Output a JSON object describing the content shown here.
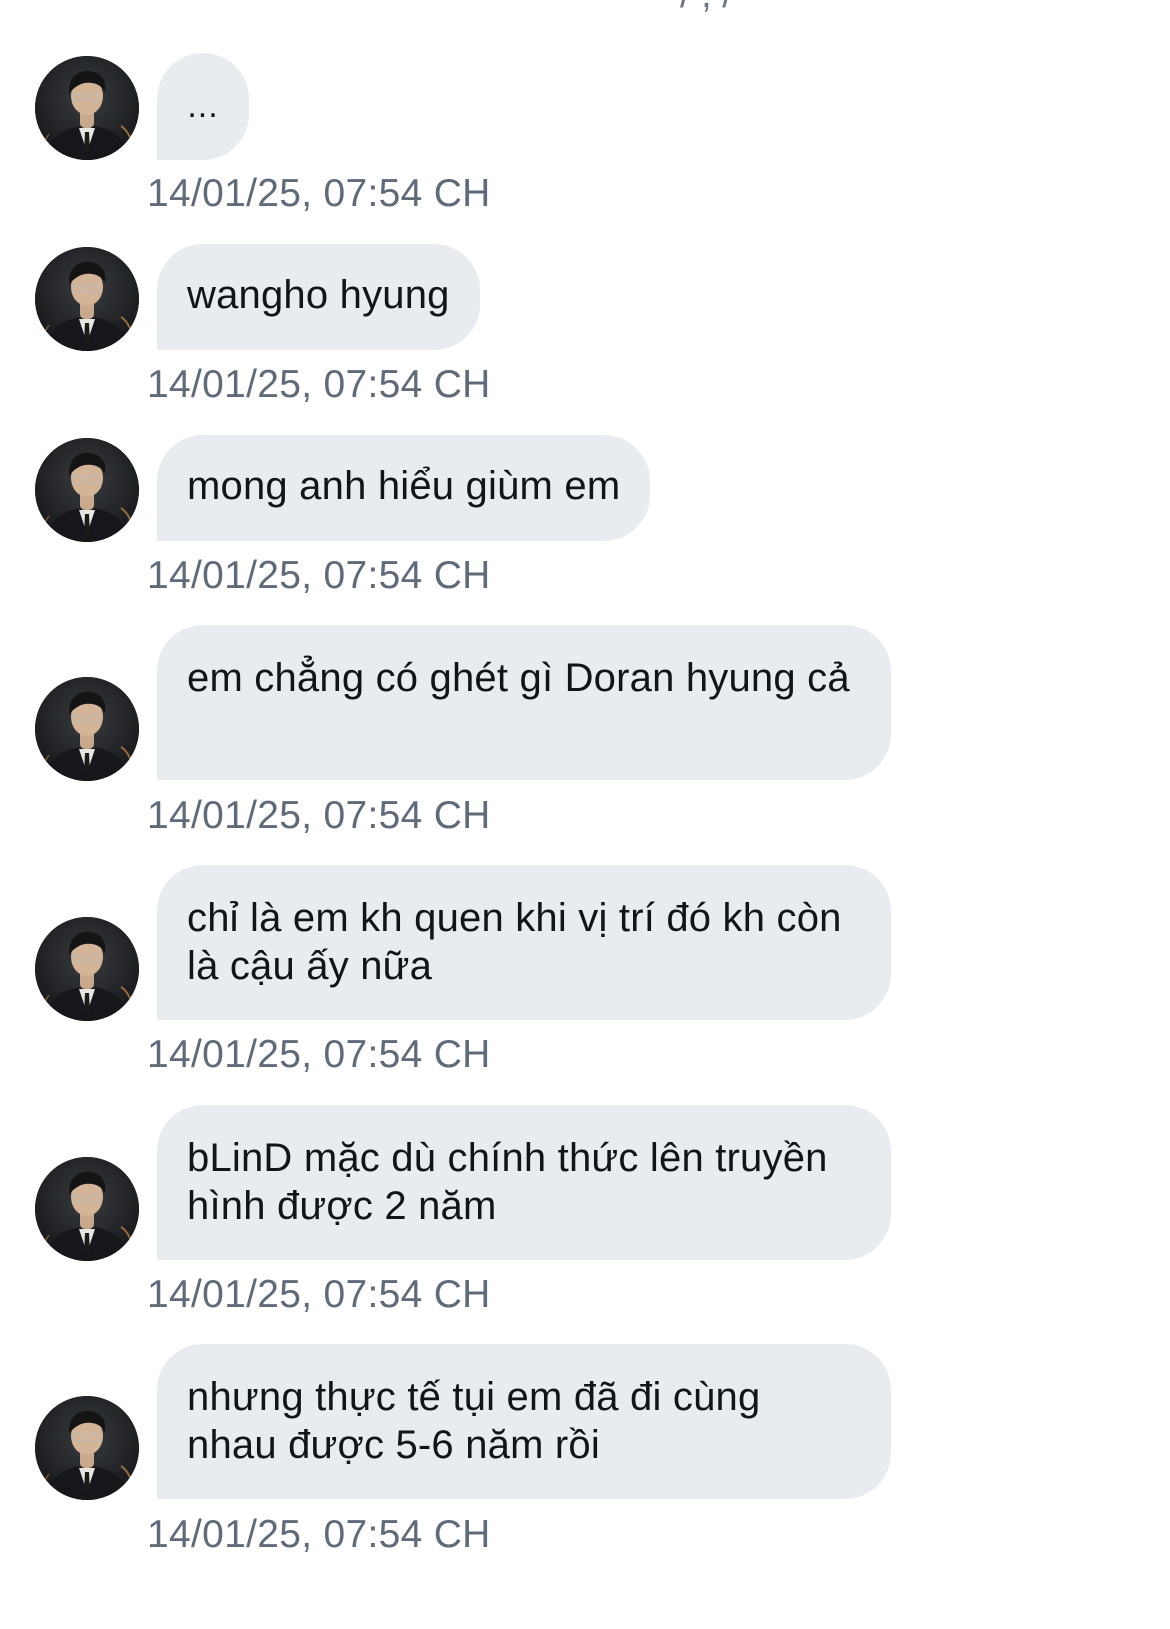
{
  "top_partial": "/ , /",
  "messages": [
    {
      "text": "...",
      "timestamp": "14/01/25, 07:54 CH"
    },
    {
      "text": "wangho hyung",
      "timestamp": "14/01/25, 07:54 CH"
    },
    {
      "text": "mong anh hiểu giùm em",
      "timestamp": "14/01/25, 07:54 CH"
    },
    {
      "text": "em chẳng có ghét gì Doran hyung cả",
      "timestamp": "14/01/25, 07:54 CH"
    },
    {
      "text": "chỉ là em kh quen khi vị trí đó kh còn là cậu ấy nữa",
      "timestamp": "14/01/25, 07:54 CH"
    },
    {
      "text": "bLinD mặc dù chính thức lên truyền hình được 2 năm",
      "timestamp": "14/01/25, 07:54 CH"
    },
    {
      "text": "nhưng thực tế tụi em đã đi cùng nhau được 5-6 năm rồi",
      "timestamp": "14/01/25, 07:54 CH"
    }
  ],
  "avatar_icon": "user-avatar-icon"
}
